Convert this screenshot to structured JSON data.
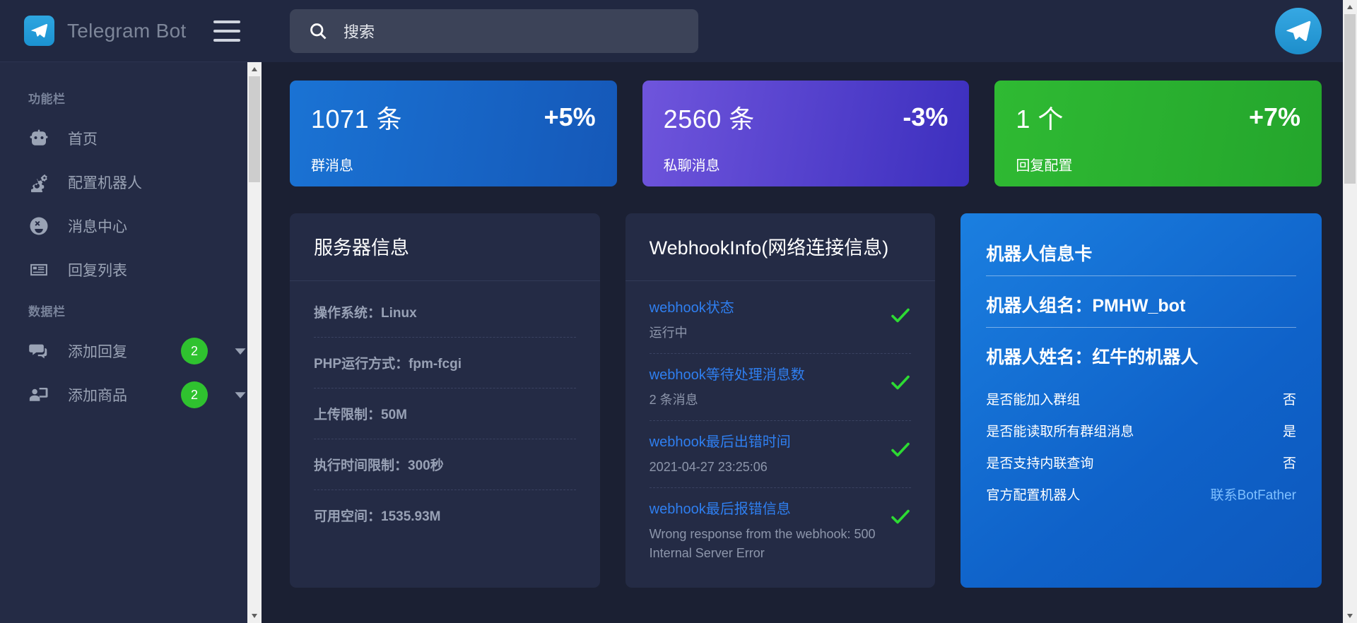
{
  "brand": {
    "title": "Telegram Bot",
    "logo_icon": "telegram-icon",
    "menu_icon": "hamburger-icon"
  },
  "search": {
    "placeholder": "搜索",
    "value": "搜索",
    "icon": "search-icon"
  },
  "topbar": {
    "avatar_icon": "telegram-avatar-icon"
  },
  "sidebar": {
    "sections": [
      {
        "title": "功能栏",
        "items": [
          {
            "label": "首页",
            "icon": "robot-icon"
          },
          {
            "label": "配置机器人",
            "icon": "gears-icon"
          },
          {
            "label": "消息中心",
            "icon": "emoji-face-icon"
          },
          {
            "label": "回复列表",
            "icon": "list-card-icon"
          }
        ]
      },
      {
        "title": "数据栏",
        "items": [
          {
            "label": "添加回复",
            "icon": "chat-bubbles-icon",
            "badge": "2",
            "caret": "chevron-down-icon"
          },
          {
            "label": "添加商品",
            "icon": "user-screen-icon",
            "badge": "2",
            "caret": "chevron-down-icon"
          }
        ]
      }
    ]
  },
  "stats": [
    {
      "value": "1071 条",
      "delta": "+5%",
      "label": "群消息",
      "color": "#1a73d4"
    },
    {
      "value": "2560 条",
      "delta": "-3%",
      "label": "私聊消息",
      "color": "#6f55dc"
    },
    {
      "value": "1 个",
      "delta": "+7%",
      "label": "回复配置",
      "color": "#2fba33"
    }
  ],
  "server_panel": {
    "title": "服务器信息",
    "rows": [
      "操作系统：Linux",
      "PHP运行方式：fpm-fcgi",
      "上传限制：50M",
      "执行时间限制：300秒",
      "可用空间：1535.93M"
    ]
  },
  "webhook_panel": {
    "title": "WebhookInfo(网络连接信息)",
    "items": [
      {
        "key": "webhook状态",
        "value": "运行中",
        "status_icon": "check-icon"
      },
      {
        "key": "webhook等待处理消息数",
        "value": "2 条消息",
        "status_icon": "check-icon"
      },
      {
        "key": "webhook最后出错时间",
        "value": "2021-04-27 23:25:06",
        "status_icon": "check-icon"
      },
      {
        "key": "webhook最后报错信息",
        "value": "Wrong response from the webhook: 500 Internal Server Error",
        "status_icon": "check-icon"
      }
    ]
  },
  "bot_card": {
    "title": "机器人信息卡",
    "group_name": "机器人组名：PMHW_bot",
    "bot_name": "机器人姓名：红牛的机器人",
    "rows": [
      {
        "key": "是否能加入群组",
        "value": "否",
        "link": false
      },
      {
        "key": "是否能读取所有群组消息",
        "value": "是",
        "link": false
      },
      {
        "key": "是否支持内联查询",
        "value": "否",
        "link": false
      },
      {
        "key": "官方配置机器人",
        "value": "联系BotFather",
        "link": true
      }
    ]
  }
}
